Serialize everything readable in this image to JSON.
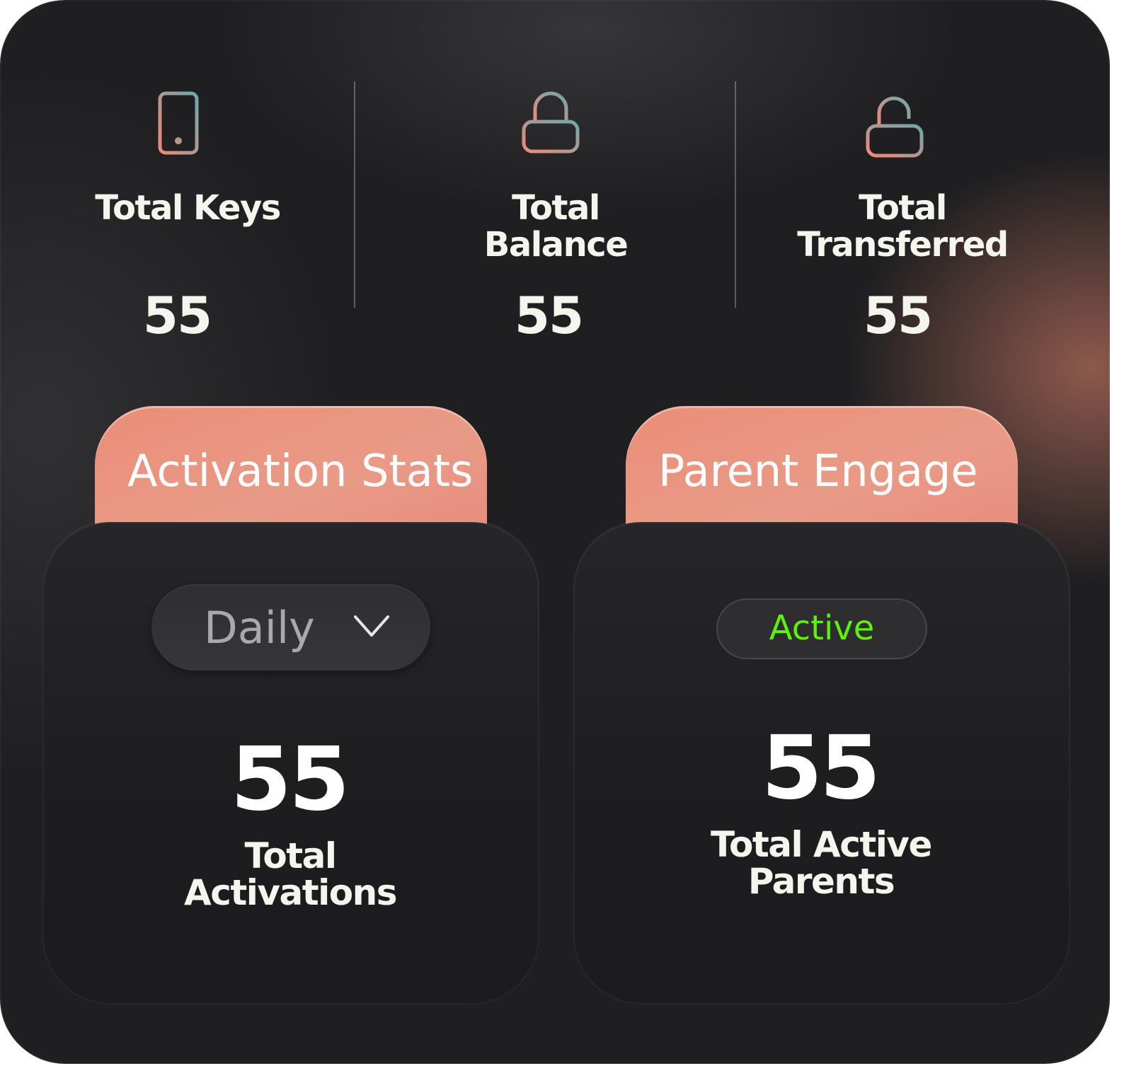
{
  "stats": [
    {
      "label": "Total Keys",
      "value": "55",
      "icon": "phone-icon"
    },
    {
      "label": "Total\nBalance",
      "value": "55",
      "icon": "lock-icon"
    },
    {
      "label": "Total\nTransferred",
      "value": "55",
      "icon": "unlock-icon"
    }
  ],
  "activation": {
    "title": "Activation Stats",
    "period": "Daily",
    "value": "55",
    "caption": "Total\nActivations"
  },
  "parent": {
    "title": "Parent Engage",
    "status": "Active",
    "value": "55",
    "caption": "Total Active\nParents"
  },
  "colors": {
    "accent": "#e8927e",
    "active_green": "#5ef10c",
    "background": "#1f1f21"
  }
}
